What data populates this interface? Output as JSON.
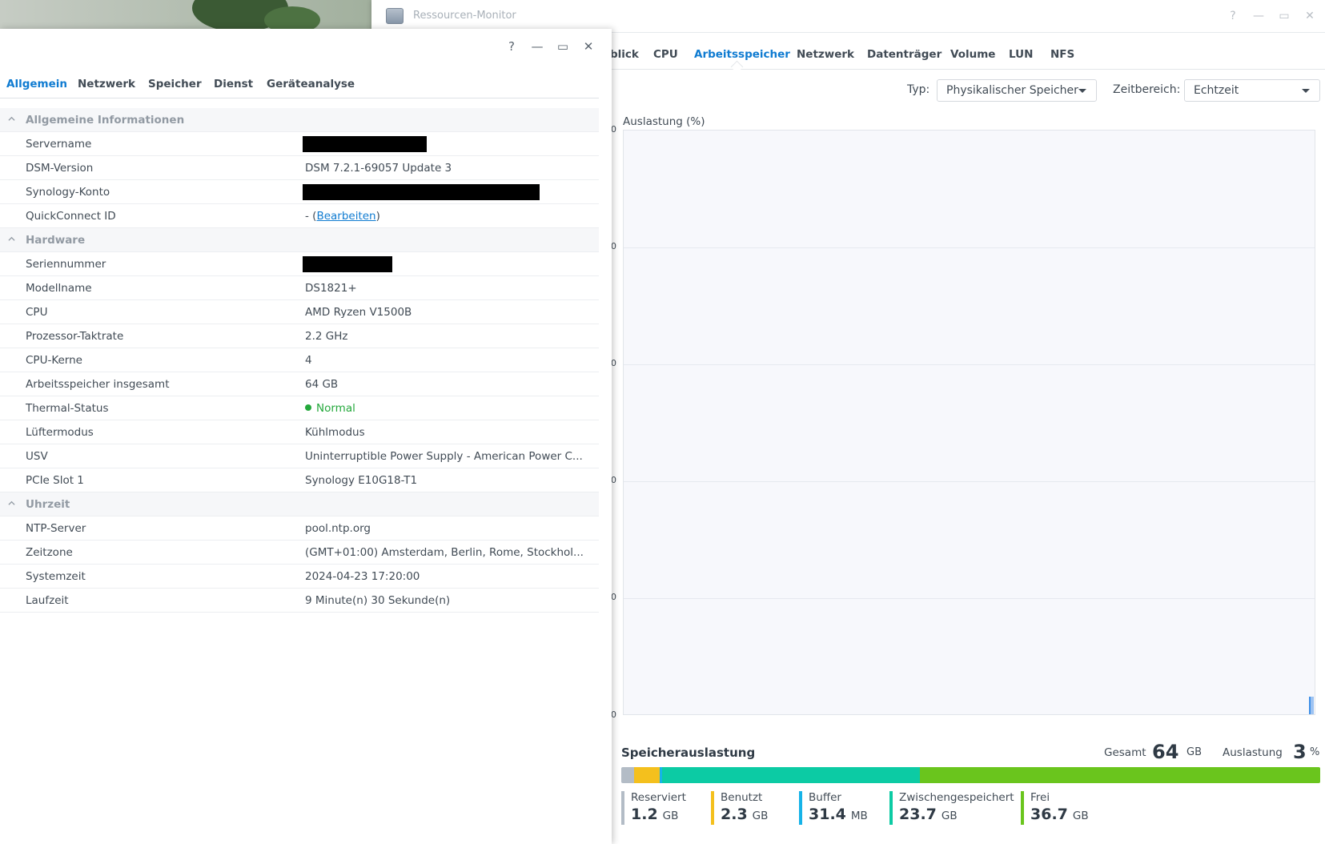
{
  "resource_monitor": {
    "title": "Ressourcen-Monitor",
    "tabs": [
      "blick",
      "CPU",
      "Arbeitsspeicher",
      "Netzwerk",
      "Datenträger",
      "Volume",
      "LUN",
      "NFS"
    ],
    "active_tab": "Arbeitsspeicher",
    "type_label": "Typ:",
    "type_value": "Physikalischer Speicher",
    "range_label": "Zeitbereich:",
    "range_value": "Echtzeit",
    "chart_title": "Auslastung (%)",
    "y_ticks": [
      "0",
      "0",
      "0",
      "0",
      "0",
      "0"
    ],
    "usage": {
      "title": "Speicherauslastung",
      "total_label": "Gesamt",
      "total_value": "64",
      "total_unit": "GB",
      "util_label": "Auslastung",
      "util_value": "3",
      "util_unit": "%"
    },
    "legend": [
      {
        "name": "Reserviert",
        "value": "1.2",
        "unit": "GB",
        "color": "#b3bcc6"
      },
      {
        "name": "Benutzt",
        "value": "2.3",
        "unit": "GB",
        "color": "#f4c01d"
      },
      {
        "name": "Buffer",
        "value": "31.4",
        "unit": "MB",
        "color": "#16b3e8"
      },
      {
        "name": "Zwischengespeichert",
        "value": "23.7",
        "unit": "GB",
        "color": "#0ccba4"
      },
      {
        "name": "Frei",
        "value": "36.7",
        "unit": "GB",
        "color": "#6ac51d"
      }
    ]
  },
  "info_center": {
    "tabs": [
      "Allgemein",
      "Netzwerk",
      "Speicher",
      "Dienst",
      "Geräteanalyse"
    ],
    "active_tab": "Allgemein",
    "sections": {
      "general": "Allgemeine Informationen",
      "hardware": "Hardware",
      "time": "Uhrzeit"
    },
    "general": {
      "servername_label": "Servername",
      "dsm_label": "DSM-Version",
      "dsm_value": "DSM 7.2.1-69057 Update 3",
      "account_label": "Synology-Konto",
      "quickconnect_label": "QuickConnect ID",
      "quickconnect_prefix": "- (",
      "quickconnect_link": "Bearbeiten",
      "quickconnect_suffix": ")"
    },
    "hardware": {
      "serial_label": "Seriennummer",
      "model_label": "Modellname",
      "model_value": "DS1821+",
      "cpu_label": "CPU",
      "cpu_value": "AMD Ryzen V1500B",
      "clock_label": "Prozessor-Taktrate",
      "clock_value": "2.2 GHz",
      "cores_label": "CPU-Kerne",
      "cores_value": "4",
      "ram_label": "Arbeitsspeicher insgesamt",
      "ram_value": "64 GB",
      "thermal_label": "Thermal-Status",
      "thermal_value": "Normal",
      "fan_label": "Lüftermodus",
      "fan_value": "Kühlmodus",
      "ups_label": "USV",
      "ups_value": "Uninterruptible Power Supply - American Power C...",
      "pcie_label": "PCIe Slot 1",
      "pcie_value": "Synology E10G18-T1"
    },
    "time": {
      "ntp_label": "NTP-Server",
      "ntp_value": "pool.ntp.org",
      "tz_label": "Zeitzone",
      "tz_value": "(GMT+01:00) Amsterdam, Berlin, Rome, Stockhol...",
      "systime_label": "Systemzeit",
      "systime_value": "2024-04-23 17:20:00",
      "uptime_label": "Laufzeit",
      "uptime_value": "9 Minute(n) 30 Sekunde(n)"
    },
    "controls": {
      "help": "?",
      "minimize": "—",
      "maximize": "▭",
      "close": "✕"
    }
  },
  "icons": [
    "help-icon",
    "minimize-icon",
    "maximize-icon",
    "close-icon",
    "chevron-up-icon",
    "dropdown-arrow-icon",
    "app-icon",
    "status-dot-icon"
  ]
}
